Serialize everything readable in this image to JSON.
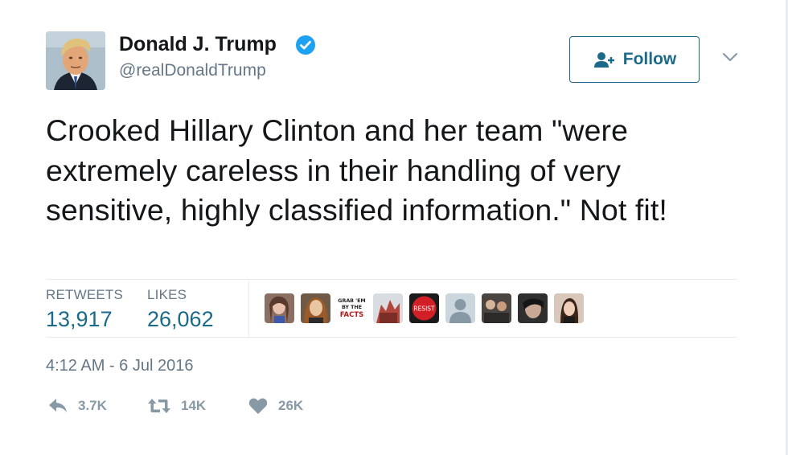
{
  "author": {
    "name": "Donald J. Trump",
    "handle": "@realDonaldTrump",
    "verified": true
  },
  "follow_button": {
    "label": "Follow",
    "icon": "add-user-icon"
  },
  "tweet": {
    "text": "Crooked Hillary Clinton and her team \"were extremely careless in their handling of very sensitive, highly classified information.\" Not fit!",
    "timestamp": "4:12 AM - 6 Jul 2016"
  },
  "stats": {
    "retweets_label": "RETWEETS",
    "retweets_value": "13,917",
    "likes_label": "LIKES",
    "likes_value": "26,062"
  },
  "likers": [
    {
      "kind": "photo",
      "name": "liker-avatar-1"
    },
    {
      "kind": "photo",
      "name": "liker-avatar-2"
    },
    {
      "kind": "text",
      "name": "liker-avatar-3",
      "lines": [
        "GRAB 'EM",
        "BY THE",
        "FACTS"
      ]
    },
    {
      "kind": "photo",
      "name": "liker-avatar-4"
    },
    {
      "kind": "text",
      "name": "liker-avatar-5",
      "lines": [
        "RESIST"
      ]
    },
    {
      "kind": "default",
      "name": "liker-avatar-6"
    },
    {
      "kind": "photo",
      "name": "liker-avatar-7"
    },
    {
      "kind": "photo",
      "name": "liker-avatar-8"
    },
    {
      "kind": "photo",
      "name": "liker-avatar-9"
    }
  ],
  "actions": {
    "reply_count": "3.7K",
    "retweet_count": "14K",
    "like_count": "26K"
  },
  "colors": {
    "link_blue": "#1b6a8a",
    "verified_blue": "#1da1f2",
    "muted_gray": "#657786",
    "action_gray": "#8899a6"
  }
}
